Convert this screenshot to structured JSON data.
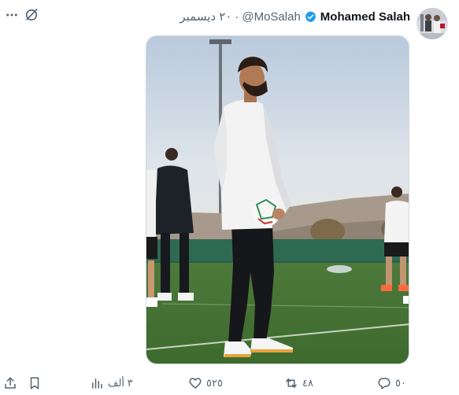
{
  "tweet": {
    "author": {
      "name": "Mohamed Salah",
      "handle": "@MoSalah",
      "verified": true,
      "avatar": "avatar-photo"
    },
    "separator": "·",
    "date": "٢٠ ديسمبر",
    "header_icons": [
      "more-icon",
      "grok-icon"
    ],
    "media": {
      "kind": "photo",
      "subject": "football-training-photo"
    },
    "actions": {
      "reply": {
        "icon": "reply-icon",
        "count": "٥٠"
      },
      "retweet": {
        "icon": "retweet-icon",
        "count": "٤٨"
      },
      "like": {
        "icon": "heart-icon",
        "count": "٥٢٥"
      },
      "views": {
        "icon": "views-icon",
        "count": "٣ ألف"
      },
      "bookmark": {
        "icon": "bookmark-icon"
      },
      "share": {
        "icon": "share-icon"
      }
    },
    "colors": {
      "text_primary": "#0f1419",
      "text_secondary": "#536471",
      "verified_blue": "#1d9bf0",
      "border": "#cfd9de"
    }
  }
}
